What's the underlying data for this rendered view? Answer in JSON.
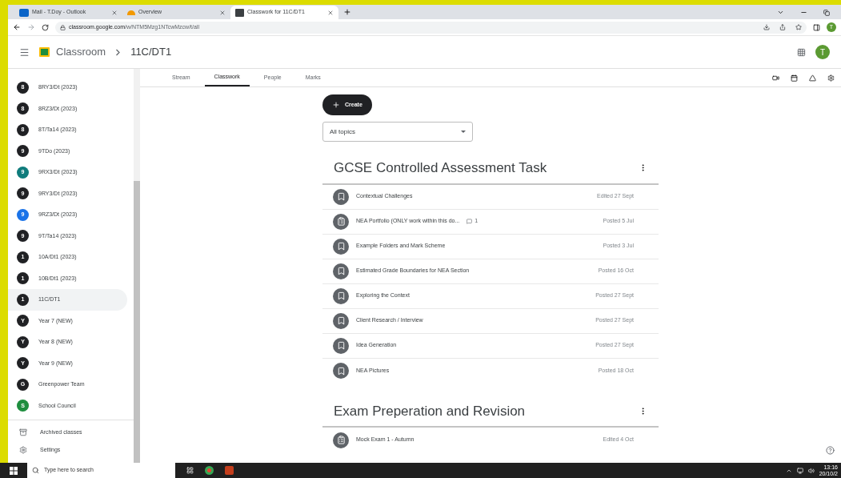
{
  "browser": {
    "tabs": [
      {
        "kind": "mail",
        "title": "Mail - T.Doy - Outlook",
        "selected": false
      },
      {
        "kind": "overview",
        "title": "Overview",
        "selected": false
      },
      {
        "kind": "classroom",
        "title": "Classwork for 11C/DT1",
        "selected": true
      }
    ],
    "url_host": "classroom.google.com",
    "url_path": "/w/NTM5Mzg1NTcwMzcw/t/all",
    "profile": "T"
  },
  "header": {
    "app": "Classroom",
    "breadcrumb": "11C/DT1",
    "avatar": "T"
  },
  "sidebar": {
    "classes": [
      {
        "badge": "8",
        "name": "8RY3/Dt (2023)",
        "color": "#202124",
        "selected": false
      },
      {
        "badge": "8",
        "name": "8RZ3/Dt (2023)",
        "color": "#202124",
        "selected": false
      },
      {
        "badge": "8",
        "name": "8T/Ta14 (2023)",
        "color": "#202124",
        "selected": false
      },
      {
        "badge": "9",
        "name": "9TDo (2023)",
        "color": "#202124",
        "selected": false
      },
      {
        "badge": "9",
        "name": "9RX3/Dt (2023)",
        "color": "#0f7c7c",
        "selected": false
      },
      {
        "badge": "9",
        "name": "9RY3/Dt (2023)",
        "color": "#202124",
        "selected": false
      },
      {
        "badge": "9",
        "name": "9RZ3/Dt (2023)",
        "color": "#1a73e8",
        "selected": false
      },
      {
        "badge": "9",
        "name": "9T/Ta14 (2023)",
        "color": "#202124",
        "selected": false
      },
      {
        "badge": "1",
        "name": "10A/Dt1 (2023)",
        "color": "#202124",
        "selected": false
      },
      {
        "badge": "1",
        "name": "10B/Dt1 (2023)",
        "color": "#202124",
        "selected": false
      },
      {
        "badge": "1",
        "name": "11C/DT1",
        "color": "#202124",
        "selected": true
      },
      {
        "badge": "Y",
        "name": "Year 7 (NEW)",
        "color": "#202124",
        "selected": false
      },
      {
        "badge": "Y",
        "name": "Year 8 (NEW)",
        "color": "#202124",
        "selected": false
      },
      {
        "badge": "Y",
        "name": "Year 9 (NEW)",
        "color": "#202124",
        "selected": false
      },
      {
        "badge": "G",
        "name": "Greenpower Team",
        "color": "#202124",
        "selected": false
      },
      {
        "badge": "S",
        "name": "School Council",
        "color": "#1e8e3e",
        "selected": false
      }
    ],
    "footer": [
      {
        "kind": "archive",
        "label": "Archived classes"
      },
      {
        "kind": "settings",
        "label": "Settings"
      }
    ]
  },
  "class_tabs": [
    {
      "label": "Stream",
      "selected": false
    },
    {
      "label": "Classwork",
      "selected": true
    },
    {
      "label": "People",
      "selected": false
    },
    {
      "label": "Marks",
      "selected": false
    }
  ],
  "create_button": "Create",
  "topic_filter": "All topics",
  "sections": [
    {
      "title": "GCSE Controlled Assessment Task",
      "items": [
        {
          "kind": "material",
          "title": "Contextual Challenges",
          "date": "Edited 27 Sept"
        },
        {
          "kind": "assignment",
          "title": "NEA Portfolio (ONLY work within this do...",
          "comments": "1",
          "date": "Posted 5 Jul"
        },
        {
          "kind": "material",
          "title": "Example Folders and Mark Scheme",
          "date": "Posted 3 Jul"
        },
        {
          "kind": "material",
          "title": "Estimated Grade Boundaries for NEA Section",
          "date": "Posted 16 Oct"
        },
        {
          "kind": "material",
          "title": "Exploring the Context",
          "date": "Posted 27 Sept"
        },
        {
          "kind": "material",
          "title": "Client Research / Interview",
          "date": "Posted 27 Sept"
        },
        {
          "kind": "material",
          "title": "Idea Generation",
          "date": "Posted 27 Sept"
        },
        {
          "kind": "material",
          "title": "NEA Pictures",
          "date": "Posted 18 Oct"
        }
      ]
    },
    {
      "title": "Exam Preperation and Revision",
      "items": [
        {
          "kind": "assignment",
          "title": "Mock Exam 1 - Autumn",
          "date": "Edited 4 Oct"
        }
      ]
    }
  ],
  "taskbar": {
    "search_placeholder": "Type here to search",
    "time": "13:16",
    "date": "20/10/2"
  }
}
